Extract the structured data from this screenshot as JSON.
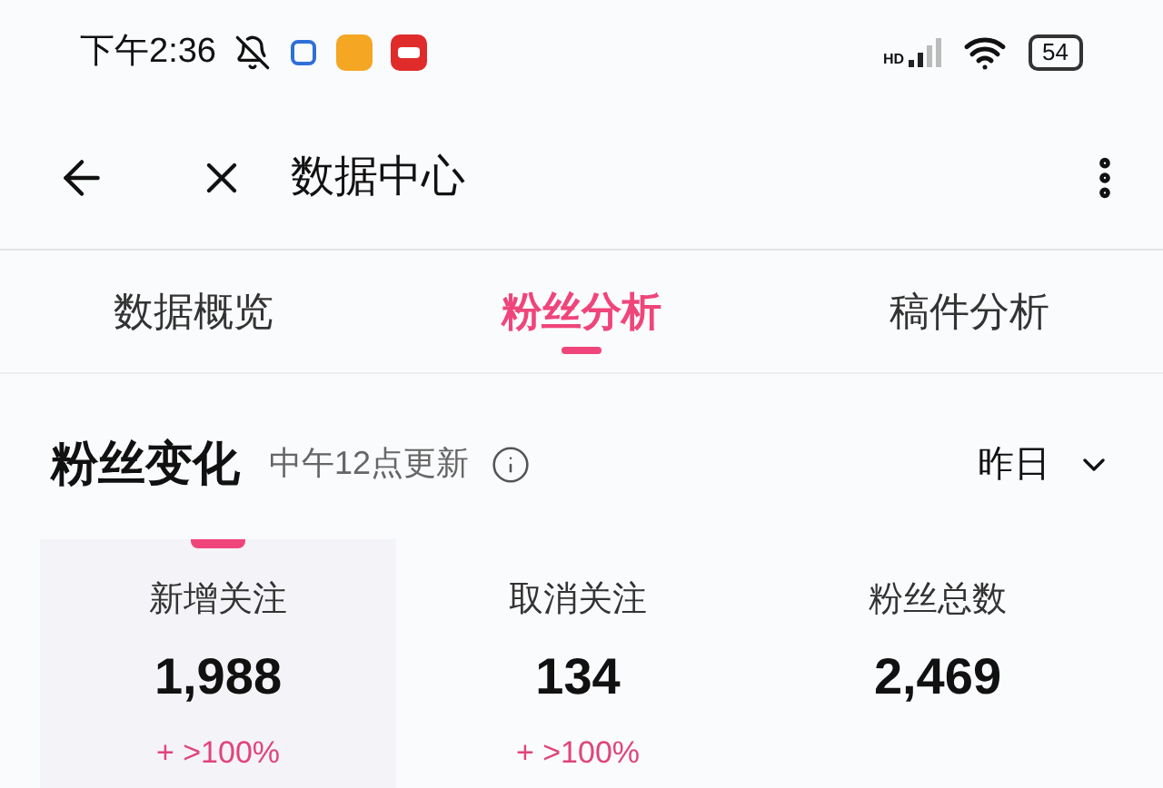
{
  "status_bar": {
    "time": "下午2:36",
    "network": "HD",
    "battery": "54"
  },
  "header": {
    "title": "数据中心"
  },
  "tabs": [
    {
      "label": "数据概览",
      "selected": false
    },
    {
      "label": "粉丝分析",
      "selected": true
    },
    {
      "label": "稿件分析",
      "selected": false
    }
  ],
  "section": {
    "title": "粉丝变化",
    "note": "中午12点更新",
    "period": "昨日"
  },
  "stats": [
    {
      "label": "新增关注",
      "value": "1,988",
      "change": "+ >100%",
      "selected": true
    },
    {
      "label": "取消关注",
      "value": "134",
      "change": "+ >100%",
      "selected": false
    },
    {
      "label": "粉丝总数",
      "value": "2,469",
      "selected": false
    }
  ]
}
